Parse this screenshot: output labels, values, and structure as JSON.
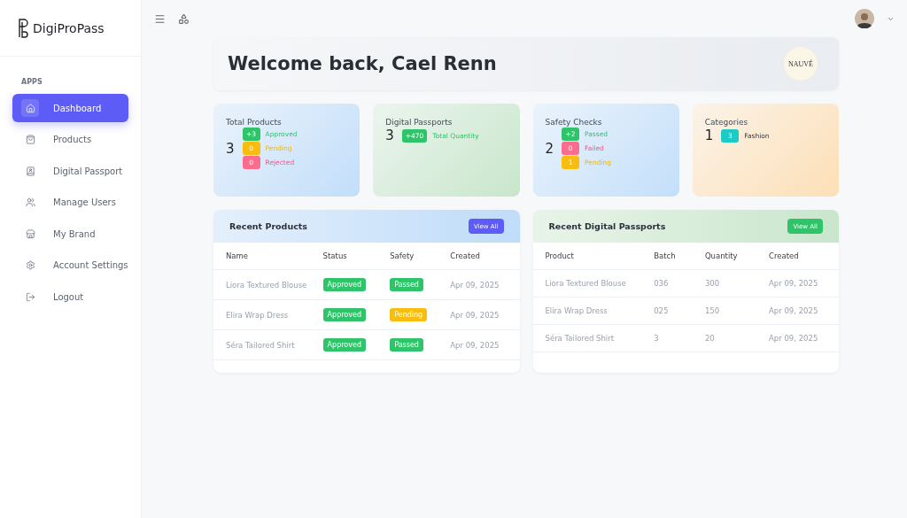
{
  "brand": {
    "name": "DigiProPass"
  },
  "sidebar": {
    "section": "APPS",
    "items": [
      {
        "label": "Dashboard",
        "selected": true
      },
      {
        "label": "Products",
        "selected": false
      },
      {
        "label": "Digital Passport",
        "selected": false
      },
      {
        "label": "Manage Users",
        "selected": false
      },
      {
        "label": "My Brand",
        "selected": false
      },
      {
        "label": "Account Settings",
        "selected": false
      },
      {
        "label": "Logout",
        "selected": false
      }
    ]
  },
  "welcome": {
    "title": "Welcome back, Cael Renn",
    "brand_logo": "NAUVÉ"
  },
  "stats": [
    {
      "title": "Total Products",
      "value": "3",
      "color": "#c2defa",
      "badges": [
        {
          "count": "+3",
          "label": "Approved",
          "kind": "success"
        },
        {
          "count": "0",
          "label": "Pending",
          "kind": "warning"
        },
        {
          "count": "0",
          "label": "Rejected",
          "kind": "danger"
        }
      ]
    },
    {
      "title": "Digital Passports",
      "value": "3",
      "color": "#c8e6cb",
      "badges": [
        {
          "count": "+470",
          "label": "Total Quantity",
          "kind": "success"
        }
      ]
    },
    {
      "title": "Safety Checks",
      "value": "2",
      "color": "#c3dffa",
      "badges": [
        {
          "count": "+2",
          "label": "Passed",
          "kind": "success"
        },
        {
          "count": "0",
          "label": "Failed",
          "kind": "danger"
        },
        {
          "count": "1",
          "label": "Pending",
          "kind": "warning"
        }
      ]
    },
    {
      "title": "Categories",
      "value": "1",
      "color": "#fddfb6",
      "badges": [
        {
          "count": "3",
          "label": "Fashion",
          "kind": "info"
        }
      ]
    }
  ],
  "recent_products": {
    "title": "Recent Products",
    "button": "View All",
    "columns": [
      "Name",
      "Status",
      "Safety",
      "Created"
    ],
    "rows": [
      {
        "name": "Liora Textured Blouse",
        "status": {
          "label": "Approved",
          "kind": "success"
        },
        "safety": {
          "label": "Passed",
          "kind": "success"
        },
        "created": "Apr 09, 2025"
      },
      {
        "name": "Elira Wrap Dress",
        "status": {
          "label": "Approved",
          "kind": "success"
        },
        "safety": {
          "label": "Pending",
          "kind": "warning"
        },
        "created": "Apr 09, 2025"
      },
      {
        "name": "Séra Tailored Shirt",
        "status": {
          "label": "Approved",
          "kind": "success"
        },
        "safety": {
          "label": "Passed",
          "kind": "success"
        },
        "created": "Apr 09, 2025"
      }
    ]
  },
  "recent_passports": {
    "title": "Recent Digital Passports",
    "button": "View All",
    "columns": [
      "Product",
      "Batch",
      "Quantity",
      "Created"
    ],
    "rows": [
      [
        "Liora Textured Blouse",
        "036",
        "300",
        "Apr 09, 2025"
      ],
      [
        "Elira Wrap Dress",
        "025",
        "150",
        "Apr 09, 2025"
      ],
      [
        "Séra Tailored Shirt",
        "3",
        "20",
        "Apr 09, 2025"
      ]
    ]
  }
}
